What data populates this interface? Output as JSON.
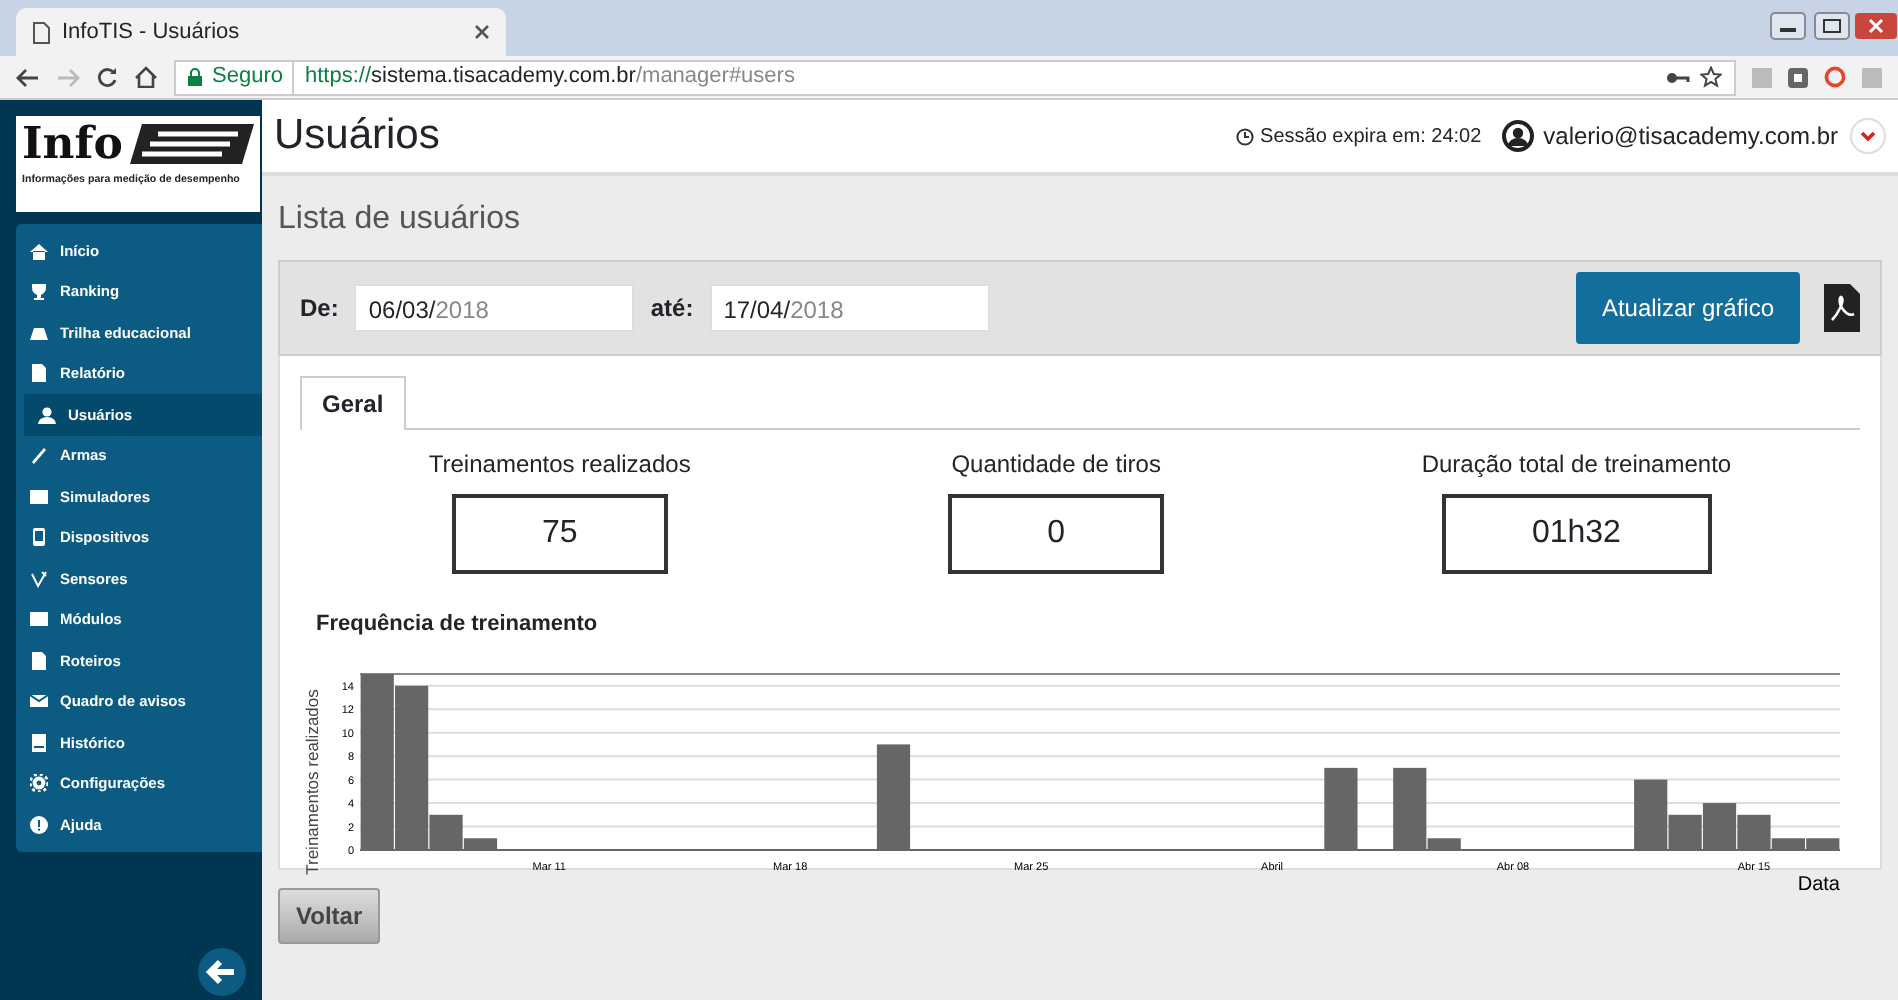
{
  "browser": {
    "tab_title": "InfoTIS - Usuários",
    "secure_label": "Seguro",
    "url_scheme": "https://",
    "url_host": "sistema.tisacademy.com.br",
    "url_path": "/manager#users"
  },
  "sidebar": {
    "logo_text": "Info",
    "logo_tagline": "Informações para medição de desempenho",
    "items": [
      {
        "label": "Início",
        "selected": false
      },
      {
        "label": "Ranking",
        "selected": false
      },
      {
        "label": "Trilha educacional",
        "selected": false
      },
      {
        "label": "Relatório",
        "selected": false
      },
      {
        "label": "Usuários",
        "selected": true
      },
      {
        "label": "Armas",
        "selected": false
      },
      {
        "label": "Simuladores",
        "selected": false
      },
      {
        "label": "Dispositivos",
        "selected": false
      },
      {
        "label": "Sensores",
        "selected": false
      },
      {
        "label": "Módulos",
        "selected": false
      },
      {
        "label": "Roteiros",
        "selected": false
      },
      {
        "label": "Quadro de avisos",
        "selected": false
      },
      {
        "label": "Histórico",
        "selected": false
      },
      {
        "label": "Configurações",
        "selected": false
      },
      {
        "label": "Ajuda",
        "selected": false
      }
    ]
  },
  "header": {
    "title": "Usuários",
    "session": "Sessão expira em: 24:02",
    "user": "valerio@tisacademy.com.br"
  },
  "page_title": "Lista de usuários",
  "filters": {
    "from_label": "De:",
    "from_day": "06/03/",
    "from_year": "2018",
    "to_label": "até:",
    "to_day": "17/04/",
    "to_year": "2018",
    "update_button": "Atualizar gráfico"
  },
  "tabs": [
    {
      "label": "Geral",
      "selected": true
    }
  ],
  "stats": [
    {
      "label": "Treinamentos realizados",
      "value": "75"
    },
    {
      "label": "Quantidade de tiros",
      "value": "0"
    },
    {
      "label": "Duração total de treinamento",
      "value": "01h32"
    }
  ],
  "chart": {
    "title": "Frequência de treinamento",
    "chart_data": {
      "type": "bar",
      "xlabel": "Data",
      "ylabel": "Treinamentos realizados",
      "categories": [
        null,
        null,
        null,
        null,
        null,
        "Mar 11",
        null,
        null,
        null,
        null,
        null,
        null,
        "Mar 18",
        null,
        null,
        null,
        null,
        null,
        null,
        "Mar 25",
        null,
        null,
        null,
        null,
        null,
        null,
        "Abril",
        null,
        null,
        null,
        null,
        null,
        null,
        "Abr 08",
        null,
        null,
        null,
        null,
        null,
        null,
        "Abr 15",
        null,
        null
      ],
      "values": [
        15,
        14,
        3,
        1,
        0,
        0,
        0,
        0,
        0,
        0,
        0,
        0,
        0,
        0,
        0,
        9,
        0,
        0,
        0,
        0,
        0,
        0,
        0,
        0,
        0,
        0,
        0,
        0,
        7,
        0,
        7,
        1,
        0,
        0,
        0,
        0,
        0,
        6,
        3,
        4,
        3,
        1,
        1
      ],
      "ylim": [
        0,
        15
      ],
      "grid": true,
      "yticks": [
        0,
        2,
        4,
        6,
        8,
        10,
        12,
        14
      ]
    }
  },
  "back_button": "Voltar"
}
